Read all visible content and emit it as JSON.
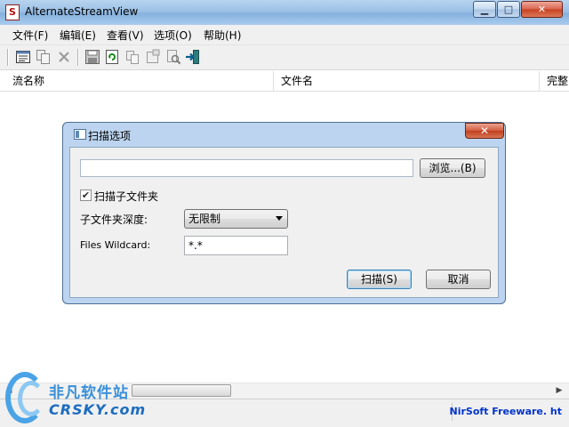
{
  "window": {
    "title": "AlternateStreamView",
    "app_icon_glyph": "S",
    "controls": {
      "minimize": "▁",
      "maximize": "□",
      "close": "✕"
    }
  },
  "menu": [
    "文件(F)",
    "编辑(E)",
    "查看(V)",
    "选项(O)",
    "帮助(H)"
  ],
  "toolbar": {
    "icons": [
      "properties-icon",
      "copy-icon",
      "delete-icon",
      "save-icon",
      "refresh-icon",
      "copy-doc-icon",
      "html-report-icon",
      "find-icon",
      "exit-icon"
    ]
  },
  "list": {
    "columns": [
      "流名称",
      "文件名",
      "完整"
    ]
  },
  "status": {
    "link": "NirSoft Freeware.  ht"
  },
  "watermark": {
    "cn": "非凡软件站",
    "en": "CRSKY.com"
  },
  "dialog": {
    "title": "扫描选项",
    "close": "✕",
    "path_value": "",
    "browse_label": "浏览...(B)",
    "scan_subfolders_label": "扫描子文件夹",
    "scan_subfolders_checked": true,
    "check_mark": "✔",
    "depth_label": "子文件夹深度:",
    "depth_value": "无限制",
    "wildcard_label": "Files Wildcard:",
    "wildcard_value": "*.*",
    "scan_button": "扫描(S)",
    "cancel_button": "取消"
  },
  "colors": {
    "titlebar": "#9cc1e6",
    "dialog_frame": "#bcd4ef",
    "status_link": "#0033cc",
    "close_button": "#c7401f"
  }
}
